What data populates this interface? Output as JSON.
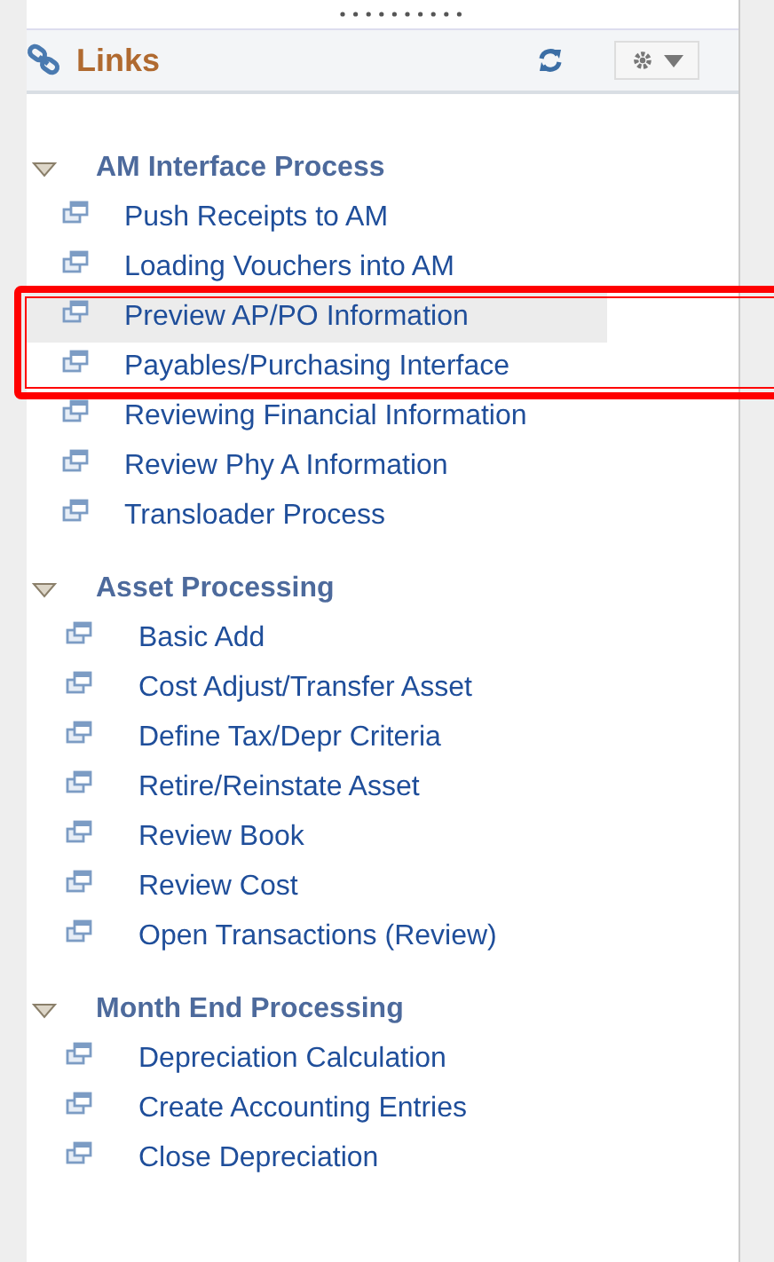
{
  "panel": {
    "title": "Links"
  },
  "groups": [
    {
      "title": "AM Interface Process",
      "expanded": true,
      "items": [
        {
          "label": "Push Receipts to AM",
          "selected": false,
          "boxed": false
        },
        {
          "label": "Loading Vouchers into AM",
          "selected": false,
          "boxed": false
        },
        {
          "label": "Preview AP/PO Information",
          "selected": true,
          "boxed": true
        },
        {
          "label": "Payables/Purchasing Interface",
          "selected": false,
          "boxed": true
        },
        {
          "label": "Reviewing Financial Information",
          "selected": false,
          "boxed": false
        },
        {
          "label": "Review Phy A Information",
          "selected": false,
          "boxed": false
        },
        {
          "label": "Transloader Process",
          "selected": false,
          "boxed": false
        }
      ]
    },
    {
      "title": "Asset Processing",
      "expanded": true,
      "items": [
        {
          "label": "Basic Add",
          "selected": false,
          "boxed": false
        },
        {
          "label": "Cost Adjust/Transfer Asset",
          "selected": false,
          "boxed": false
        },
        {
          "label": "Define Tax/Depr Criteria",
          "selected": false,
          "boxed": false
        },
        {
          "label": "Retire/Reinstate Asset",
          "selected": false,
          "boxed": false
        },
        {
          "label": "Review Book",
          "selected": false,
          "boxed": false
        },
        {
          "label": "Review Cost",
          "selected": false,
          "boxed": false
        },
        {
          "label": "Open Transactions (Review)",
          "selected": false,
          "boxed": false
        }
      ]
    },
    {
      "title": "Month End Processing",
      "expanded": true,
      "items": [
        {
          "label": "Depreciation Calculation",
          "selected": false,
          "boxed": false
        },
        {
          "label": "Create Accounting Entries",
          "selected": false,
          "boxed": false
        },
        {
          "label": "Close Depreciation",
          "selected": false,
          "boxed": false
        }
      ]
    }
  ]
}
